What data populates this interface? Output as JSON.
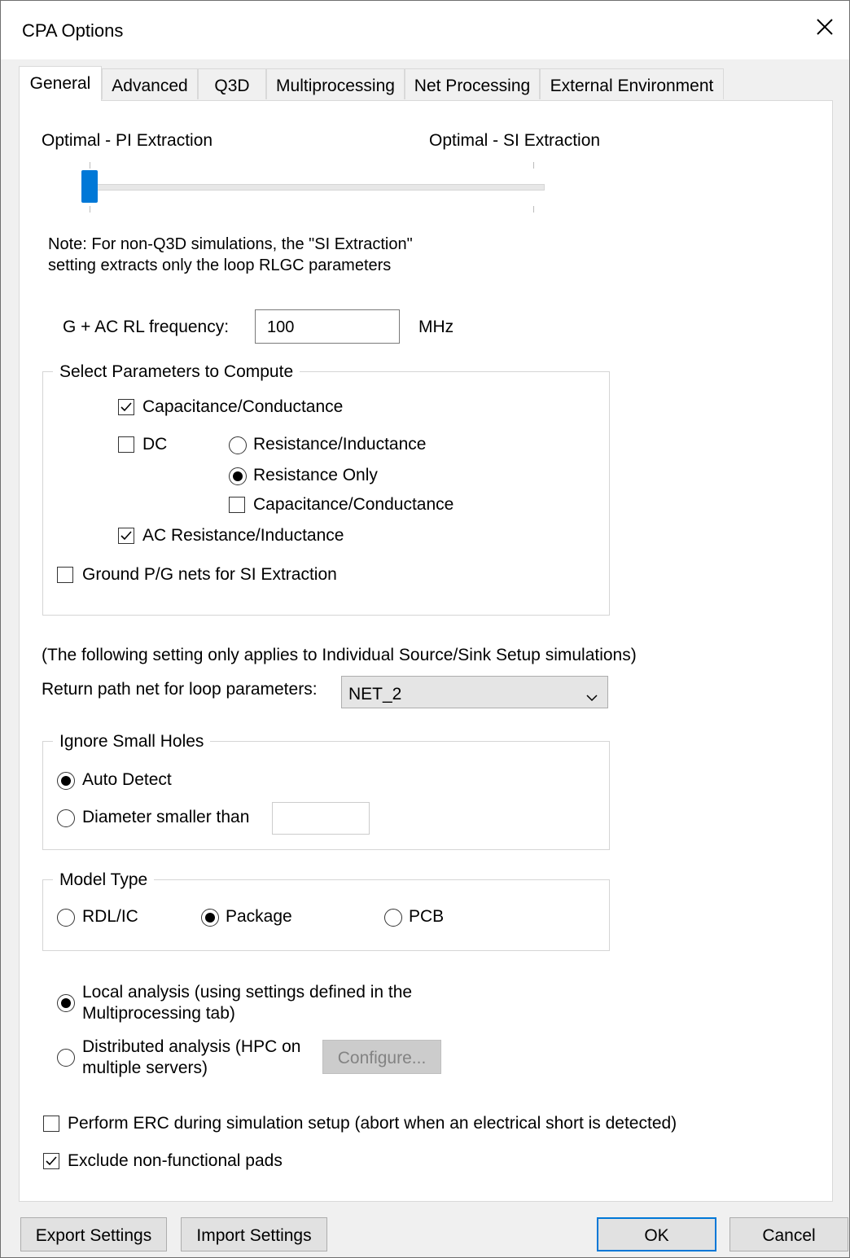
{
  "window": {
    "title": "CPA Options",
    "close_icon": "close-icon"
  },
  "tabs": [
    "General",
    "Advanced",
    "Q3D",
    "Multiprocessing",
    "Net Processing",
    "External Environment"
  ],
  "slider": {
    "left_label": "Optimal - PI Extraction",
    "right_label": "Optimal - SI Extraction",
    "value": 0,
    "accent": "#0078d7"
  },
  "note": {
    "line1": "Note: For non-Q3D simulations, the \"SI Extraction\"",
    "line2": "setting extracts only the loop RLGC parameters"
  },
  "frequency": {
    "label": "G + AC RL frequency:",
    "value": "100",
    "unit": "MHz"
  },
  "params_group": {
    "title": "Select Parameters to Compute",
    "cap_cond": {
      "label": "Capacitance/Conductance",
      "checked": true
    },
    "dc": {
      "label": "DC",
      "checked": false
    },
    "dc_res_ind": {
      "label": "Resistance/Inductance",
      "selected": false
    },
    "dc_res_only": {
      "label": "Resistance Only",
      "selected": true
    },
    "dc_cap_cond": {
      "label": "Capacitance/Conductance",
      "checked": false
    },
    "ac_res_ind": {
      "label": "AC Resistance/Inductance",
      "checked": true
    },
    "ground_pg": {
      "label": "Ground P/G nets for SI Extraction",
      "checked": false
    }
  },
  "individual_note": "(The following setting only applies to Individual Source/Sink Setup simulations)",
  "return_path": {
    "label": "Return path net for loop parameters:",
    "value": "NET_2"
  },
  "holes_group": {
    "title": "Ignore Small Holes",
    "auto": {
      "label": "Auto Detect",
      "selected": true
    },
    "diameter": {
      "label": "Diameter smaller than",
      "selected": false,
      "value": ""
    }
  },
  "model_group": {
    "title": "Model Type",
    "rdl": {
      "label": "RDL/IC",
      "selected": false
    },
    "package": {
      "label": "Package",
      "selected": true
    },
    "pcb": {
      "label": "PCB",
      "selected": false
    }
  },
  "analysis": {
    "local": {
      "line1": "Local analysis (using settings defined in the",
      "line2": "Multiprocessing tab)",
      "selected": true
    },
    "distributed": {
      "line1": "Distributed analysis (HPC on",
      "line2": "multiple servers)",
      "selected": false
    },
    "configure_label": "Configure..."
  },
  "erc": {
    "label": "Perform ERC during simulation setup (abort when an electrical short is detected)",
    "checked": false
  },
  "exclude_pads": {
    "label": "Exclude non-functional pads",
    "checked": true
  },
  "footer": {
    "export": "Export Settings",
    "import": "Import Settings",
    "ok": "OK",
    "cancel": "Cancel"
  }
}
